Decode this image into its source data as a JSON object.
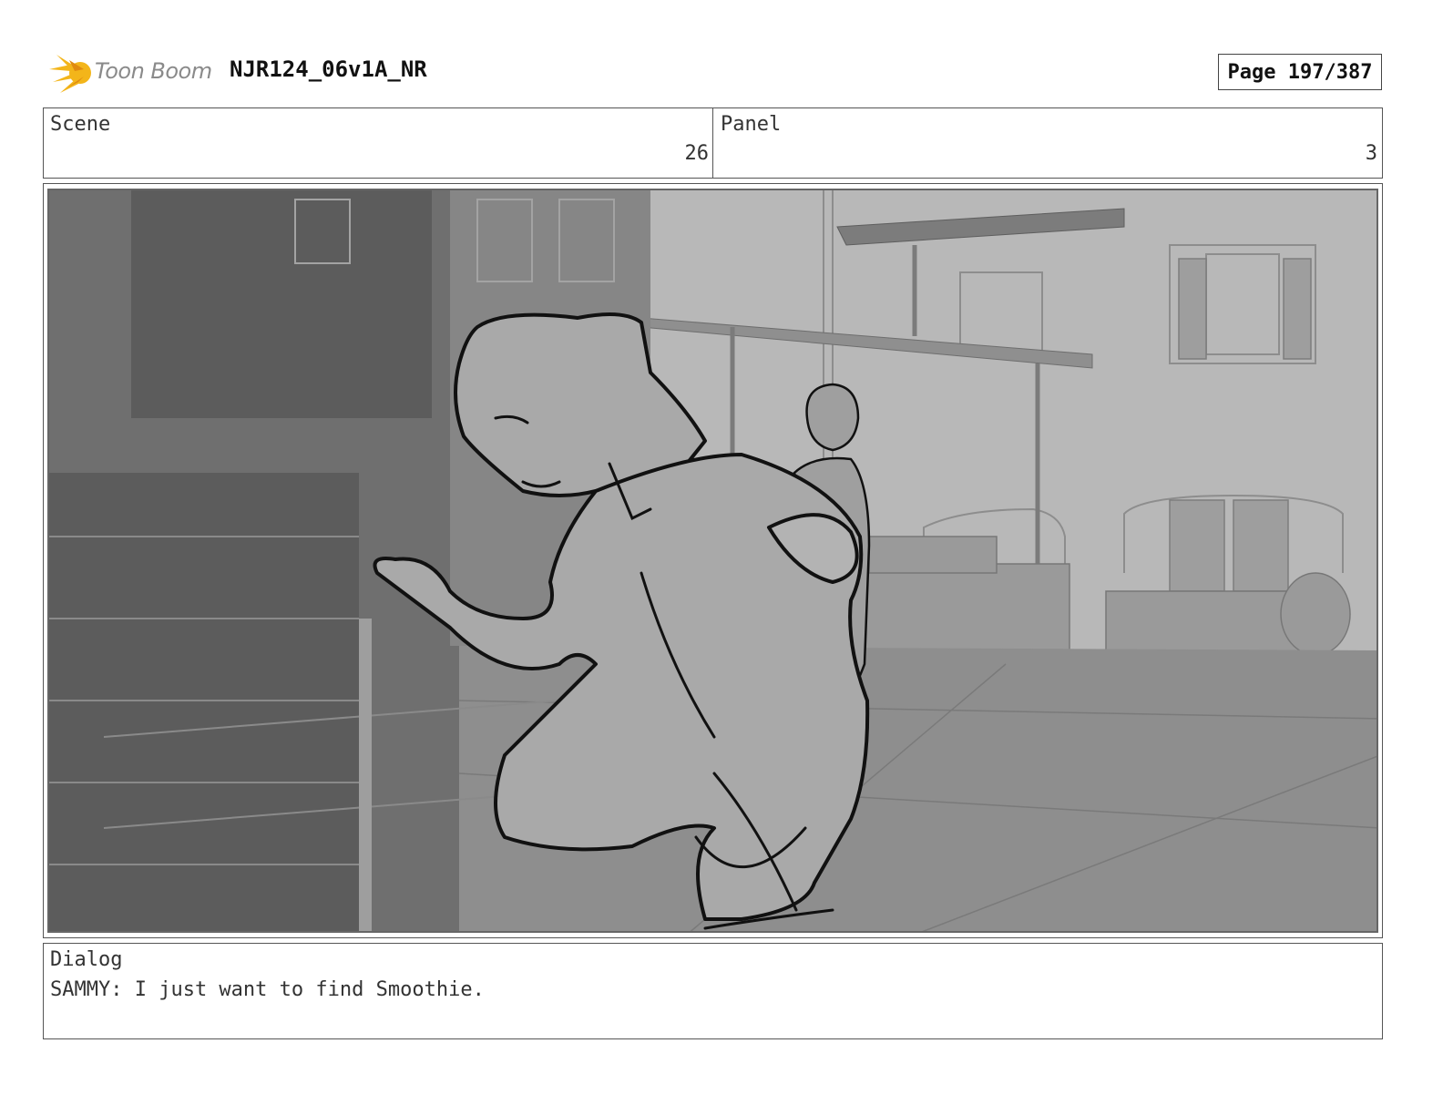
{
  "header": {
    "brand": "Toon Boom",
    "title": "NJR124_06v1A_NR",
    "page": "Page 197/387"
  },
  "info": {
    "scene_label": "Scene",
    "scene_number": "26",
    "panel_label": "Panel",
    "panel_number": "3"
  },
  "frame": {
    "description_icon": "storyboard-sketch-illustration",
    "colors": {
      "background": "#a6a6a6",
      "lines": "#111111",
      "shadow": "#707070"
    }
  },
  "dialog": {
    "label": "Dialog",
    "text": "SAMMY: I just want to find Smoothie."
  }
}
